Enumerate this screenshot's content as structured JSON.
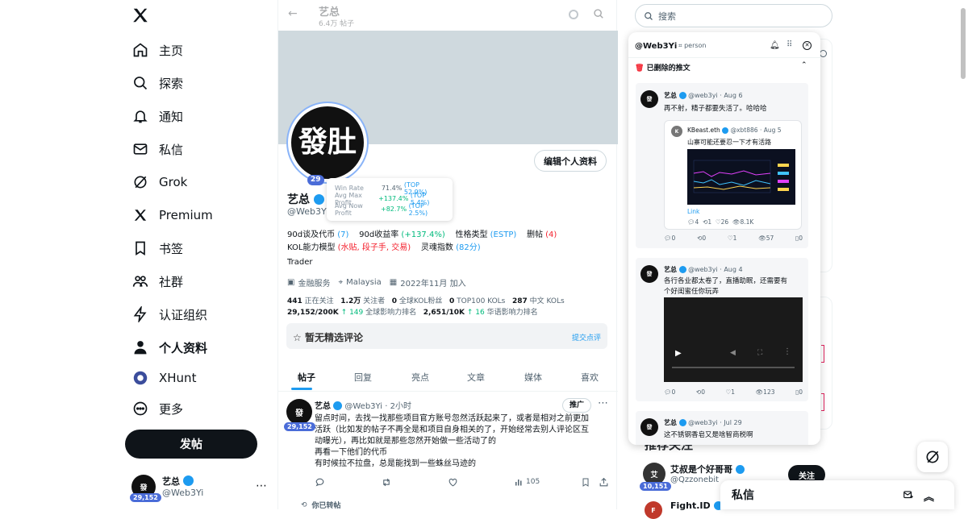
{
  "nav": {
    "items": [
      {
        "label": "主页",
        "icon": "home-icon"
      },
      {
        "label": "探索",
        "icon": "search-icon"
      },
      {
        "label": "通知",
        "icon": "bell-icon"
      },
      {
        "label": "私信",
        "icon": "mail-icon"
      },
      {
        "label": "Grok",
        "icon": "grok-icon"
      },
      {
        "label": "Premium",
        "icon": "x-logo-icon"
      },
      {
        "label": "书签",
        "icon": "bookmark-icon"
      },
      {
        "label": "社群",
        "icon": "people-icon"
      },
      {
        "label": "认证组织",
        "icon": "lightning-icon"
      },
      {
        "label": "个人资料",
        "icon": "person-icon"
      },
      {
        "label": "XHunt",
        "icon": "xhunt-icon"
      },
      {
        "label": "更多",
        "icon": "more-circle-icon"
      }
    ],
    "post_label": "发帖",
    "me": {
      "name": "艺总",
      "handle": "@Web3Yi",
      "badge": "29,152"
    }
  },
  "profile": {
    "header_name": "艺总",
    "header_sub": "6.4万 帖子",
    "avatar_text": "發肚",
    "badge": "29",
    "name": "艺总",
    "handle": "@Web3Yi",
    "edit_label": "编辑个人资料",
    "tooltip": [
      {
        "label": "Win Rate",
        "value": "71.4%",
        "extra": "(TOP 52.9%)"
      },
      {
        "label": "Avg Max Profit",
        "value": "+137.4%",
        "extra": "(TOP 5.4%)"
      },
      {
        "label": "Avg Now Profit",
        "value": "+82.7%",
        "extra": "(TOP 2.5%)"
      }
    ],
    "stats1": {
      "calls": "90d谈及代币",
      "calls_val": "(7)",
      "ret": "90d收益率",
      "ret_val": "(+137.4%)",
      "ptype": "性格类型",
      "ptype_val": "(ESTP)",
      "del": "删帖",
      "del_val": "(4)"
    },
    "stats2": {
      "kol": "KOL能力模型",
      "kol_val": "(水贴, 段子手, 交易)",
      "soul": "灵魂指数",
      "soul_val": "(82分)"
    },
    "bio": "Trader",
    "meta": {
      "category": "金融服务",
      "location": "Malaysia",
      "joined": "2022年11月 加入"
    },
    "follow": {
      "following": "441",
      "following_label": "正在关注",
      "followers": "1.2万",
      "followers_label": "关注者",
      "kol_fans": "0",
      "kol_fans_label": "全球KOL粉丝",
      "top100": "0",
      "top100_label": "TOP100 KOLs",
      "cn": "287",
      "cn_label": "中文 KOLs"
    },
    "rank": {
      "global": "29,152/200K",
      "global_delta": "149",
      "global_label": "全球影响力排名",
      "cn": "2,651/10K",
      "cn_delta": "16",
      "cn_label": "华语影响力排名"
    },
    "comment": {
      "title": "暂无精选评论",
      "submit": "提交点评"
    },
    "tabs": [
      "帖子",
      "回复",
      "亮点",
      "文章",
      "媒体",
      "喜欢"
    ]
  },
  "tweet": {
    "name": "艺总",
    "handle": "@Web3Yi",
    "time": "· 2小时",
    "badge": "29,152",
    "promo": "推广",
    "lines": [
      "留点时间，去找一找那些项目官方账号忽然活跃起来了，或者是相对之前更加",
      "活跃（比如发的帖子不再全是和项目自身相关的了，开始经常去别人评论区互",
      "动曝光），再比如就是那些忽然开始做一些活动了的",
      "再看一下他们的代币",
      "有时候拉不拉盘，总是能找到一些蛛丝马迹的"
    ],
    "views": "105",
    "retweet_label": "你已转帖"
  },
  "right": {
    "search_placeholder": "搜索",
    "panel": {
      "handle": "@Web3Yi",
      "tag": "person",
      "section": "已删除的推文",
      "tweets": [
        {
          "name": "艺总",
          "handle": "@web3yi · Aug 6",
          "text": "再不射，精子都要失活了。哈哈哈",
          "quote": {
            "name": "KBeast.eth",
            "handle": "@xbt886 · Aug 5",
            "text": "山寨可能还要忍一下才有活路",
            "link": "Link",
            "stats": [
              "4",
              "1",
              "26",
              "8.1K"
            ]
          },
          "stats": [
            "0",
            "0",
            "1",
            "57",
            "0"
          ]
        },
        {
          "name": "艺总",
          "handle": "@web3yi · Aug 4",
          "text1": "各行各业都太卷了，直播助眠，还需要有",
          "text2": "个好闺蜜任你玩弄",
          "stats": [
            "0",
            "0",
            "1",
            "123",
            "0"
          ]
        },
        {
          "name": "艺总",
          "handle": "@web3yi · Jul 29",
          "text": "这不锈钢香皂又是啥智商税啊"
        }
      ]
    },
    "who": {
      "partial": "推荐关注",
      "name": "艾叔是个好哥哥",
      "handle": "@Qzzonebit",
      "badge": "10,151",
      "follow": "关注",
      "name2": "Fight.ID"
    },
    "dm_label": "私信"
  }
}
